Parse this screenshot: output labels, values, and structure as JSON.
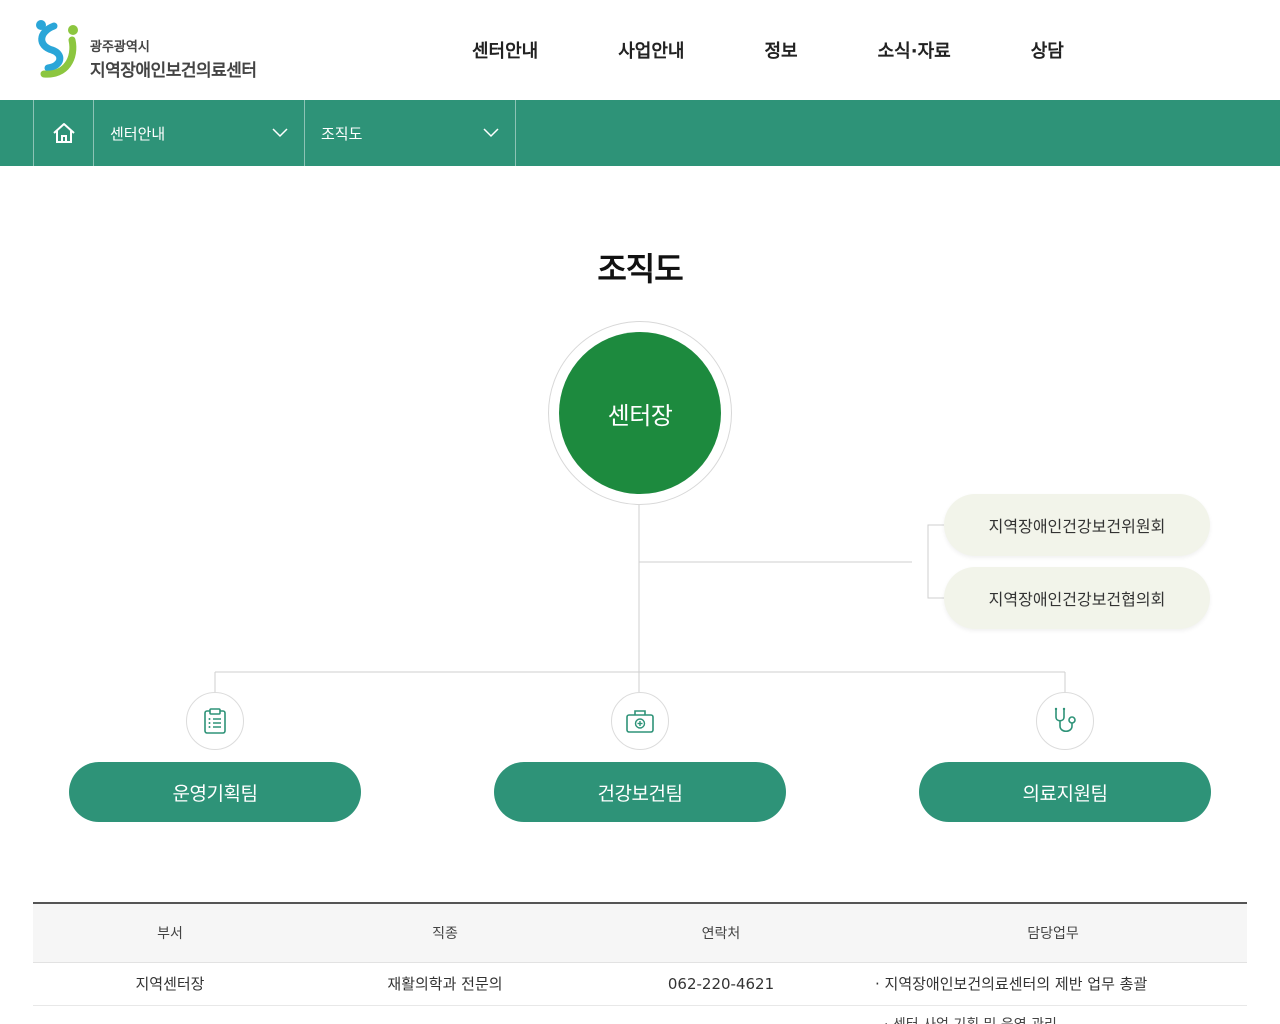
{
  "header": {
    "logo_sub": "광주광역시",
    "logo_main": "지역장애인보건의료센터",
    "nav": [
      "센터안내",
      "사업안내",
      "정보",
      "소식·자료",
      "상담"
    ]
  },
  "location": {
    "depth1": "센터안내",
    "depth2": "조직도"
  },
  "page_title": "조직도",
  "org": {
    "head": "센터장",
    "committees": [
      "지역장애인건강보건위원회",
      "지역장애인건강보건협의회"
    ],
    "teams": [
      {
        "label": "운영기획팀",
        "icon": "clipboard-list-icon"
      },
      {
        "label": "건강보건팀",
        "icon": "medical-kit-icon"
      },
      {
        "label": "의료지원팀",
        "icon": "stethoscope-icon"
      }
    ]
  },
  "table": {
    "headers": [
      "부서",
      "직종",
      "연락처",
      "담당업무"
    ],
    "rows": [
      {
        "dept": "지역센터장",
        "job": "재활의학과 전문의",
        "phone": "062-220-4621",
        "duty": "· 지역장애인보건의료센터의 제반 업무 총괄"
      }
    ],
    "partial_next_duty": "· 센터 사업 기획 및 운영 관리"
  },
  "colors": {
    "primary": "#2e9378",
    "head_circle": "#1d8a3e",
    "committee_bg": "#f2f4ea"
  }
}
